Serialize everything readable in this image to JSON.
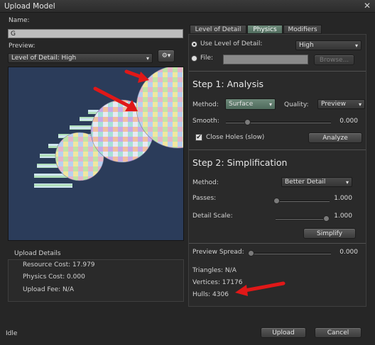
{
  "window": {
    "title": "Upload Model",
    "close_glyph": "✕"
  },
  "name": {
    "label": "Name:",
    "value": "G"
  },
  "preview": {
    "label": "Preview:",
    "selected": "Level of Detail: High",
    "gear_glyph": "⚙▾"
  },
  "upload_details": {
    "title": "Upload Details",
    "resource_cost": "Resource Cost: 17.979",
    "physics_cost": "Physics Cost: 0.000",
    "upload_fee": "Upload Fee: N/A"
  },
  "status": "Idle",
  "footer": {
    "upload": "Upload",
    "cancel": "Cancel"
  },
  "tabs": [
    "Level of Detail",
    "Physics",
    "Modifiers"
  ],
  "lod": {
    "use_label": "Use Level of Detail:",
    "use_value": "High",
    "file_label": "File:",
    "browse": "Browse..."
  },
  "step1": {
    "title": "Step 1: Analysis",
    "method_label": "Method:",
    "method_value": "Surface",
    "quality_label": "Quality:",
    "quality_value": "Preview",
    "smooth_label": "Smooth:",
    "smooth_value": "0.000",
    "close_holes": "Close Holes (slow)",
    "close_holes_mark": "✔",
    "analyze": "Analyze"
  },
  "step2": {
    "title": "Step 2: Simplification",
    "method_label": "Method:",
    "method_value": "Better Detail",
    "passes_label": "Passes:",
    "passes_value": "1.000",
    "detail_label": "Detail Scale:",
    "detail_value": "1.000",
    "simplify": "Simplify"
  },
  "results": {
    "spread_label": "Preview Spread:",
    "spread_value": "0.000",
    "triangles": "Triangles: N/A",
    "vertices": "Vertices: 17176",
    "hulls": "Hulls: 4306"
  },
  "colors": {
    "annotation_arrow": "#e01818",
    "viewport": "#2b3c5a",
    "active_tab": "#5c7a6a"
  },
  "icons": {
    "dropdown": "▾"
  }
}
